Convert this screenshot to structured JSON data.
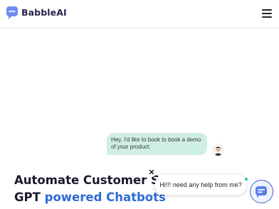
{
  "header": {
    "logo_text": "BabbleAI",
    "logo_icon": "chat-bubble-logo-icon",
    "menu_icon": "hamburger-menu-icon"
  },
  "hero": {
    "chat_message": "Hey, I'd like to book to book a demo of your product.",
    "headline_line1": "Automate Customer Sup",
    "headline_line2_a": "GPT",
    "headline_line2_b": "powered Chatbots"
  },
  "widget": {
    "greeting": "Hi!!! need any help from me?",
    "close_icon": "close-icon",
    "launcher_icon": "chat-launcher-icon"
  },
  "colors": {
    "brand_dark": "#26264a",
    "accent_blue": "#2f6bd6",
    "bubble_bg": "#cfeee4",
    "online_green": "#1fcf8f"
  }
}
